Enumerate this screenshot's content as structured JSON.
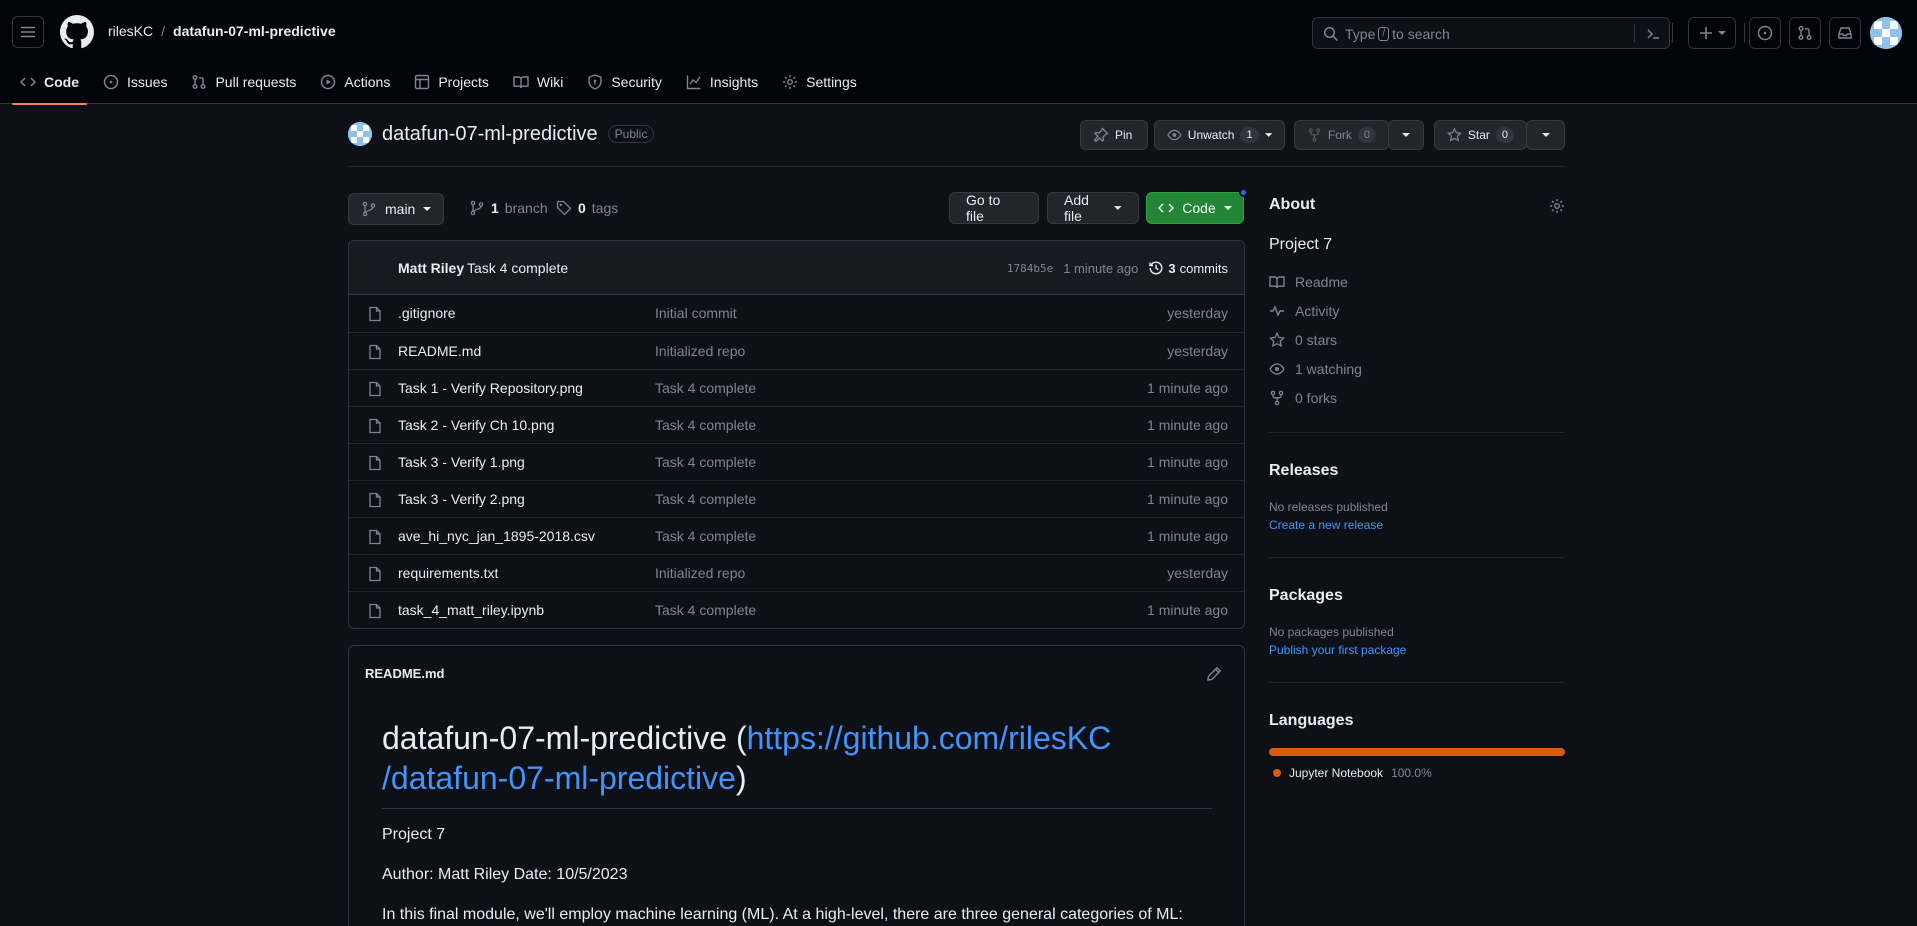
{
  "header": {
    "owner": "rilesKC",
    "separator": "/",
    "repo": "datafun-07-ml-predictive",
    "search_placeholder_pre": "Type",
    "search_key": "/",
    "search_placeholder_post": "to search"
  },
  "nav": {
    "tabs": [
      {
        "label": "Code",
        "icon": "code-icon",
        "active": true
      },
      {
        "label": "Issues",
        "icon": "issue-icon"
      },
      {
        "label": "Pull requests",
        "icon": "pull-request-icon"
      },
      {
        "label": "Actions",
        "icon": "play-icon"
      },
      {
        "label": "Projects",
        "icon": "table-icon"
      },
      {
        "label": "Wiki",
        "icon": "book-icon"
      },
      {
        "label": "Security",
        "icon": "shield-icon"
      },
      {
        "label": "Insights",
        "icon": "graph-icon"
      },
      {
        "label": "Settings",
        "icon": "gear-icon"
      }
    ]
  },
  "repo": {
    "name": "datafun-07-ml-predictive",
    "visibility": "Public",
    "pin_label": "Pin",
    "unwatch_label": "Unwatch",
    "watch_count": "1",
    "fork_label": "Fork",
    "fork_count": "0",
    "star_label": "Star",
    "star_count": "0"
  },
  "branch": {
    "current": "main",
    "branch_count": "1",
    "branch_word": "branch",
    "tag_count": "0",
    "tag_word": "tags",
    "goto_file": "Go to file",
    "add_file": "Add file",
    "code": "Code"
  },
  "commit": {
    "author": "Matt Riley",
    "message": "Task 4 complete",
    "sha": "1784b5e",
    "age": "1 minute ago",
    "count": "3",
    "count_word": "commits"
  },
  "files": [
    {
      "name": ".gitignore",
      "message": "Initial commit",
      "age": "yesterday"
    },
    {
      "name": "README.md",
      "message": "Initialized repo",
      "age": "yesterday"
    },
    {
      "name": "Task 1 - Verify Repository.png",
      "message": "Task 4 complete",
      "age": "1 minute ago"
    },
    {
      "name": "Task 2 - Verify Ch 10.png",
      "message": "Task 4 complete",
      "age": "1 minute ago"
    },
    {
      "name": "Task 3 - Verify 1.png",
      "message": "Task 4 complete",
      "age": "1 minute ago"
    },
    {
      "name": "Task 3 - Verify 2.png",
      "message": "Task 4 complete",
      "age": "1 minute ago"
    },
    {
      "name": "ave_hi_nyc_jan_1895-2018.csv",
      "message": "Task 4 complete",
      "age": "1 minute ago"
    },
    {
      "name": "requirements.txt",
      "message": "Initialized repo",
      "age": "yesterday"
    },
    {
      "name": "task_4_matt_riley.ipynb",
      "message": "Task 4 complete",
      "age": "1 minute ago"
    }
  ],
  "readme": {
    "filename": "README.md",
    "h1_text": "datafun-07-ml-predictive (",
    "h1_link_line1": "https://github.com/rilesKC",
    "h1_link_line2": "/datafun-07-ml-predictive",
    "h1_close": ")",
    "p1": "Project 7",
    "p2": "Author: Matt Riley Date: 10/5/2023",
    "p3": "In this final module, we'll employ machine learning (ML). At a high-level, there are three general categories of ML:"
  },
  "about": {
    "heading": "About",
    "description": "Project 7",
    "readme": "Readme",
    "activity": "Activity",
    "stars": "0 stars",
    "watching": "1 watching",
    "forks": "0 forks"
  },
  "releases": {
    "heading": "Releases",
    "none": "No releases published",
    "create": "Create a new release"
  },
  "packages": {
    "heading": "Packages",
    "none": "No packages published",
    "publish": "Publish your first package"
  },
  "languages": {
    "heading": "Languages",
    "items": [
      {
        "name": "Jupyter Notebook",
        "percent": "100.0%",
        "color": "#da5b0b"
      }
    ]
  },
  "colors": {
    "bg": "#0d1117",
    "header_bg": "#010409",
    "accent_green": "#238636",
    "link_blue": "#4493f8",
    "active_tab": "#f78166"
  }
}
